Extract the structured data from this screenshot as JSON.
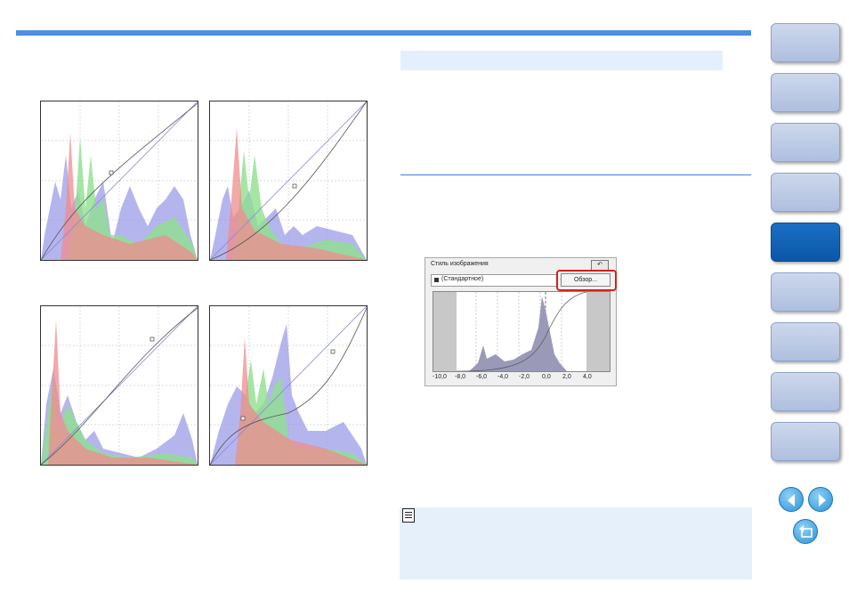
{
  "colors": {
    "accent": "#4f8ee0",
    "section_bg": "#e3effc",
    "note_bg": "#e5f0fb",
    "nav_active": "#0b57a8",
    "nav_inactive": "#b8c8e4",
    "highlight": "#d81e1e"
  },
  "panel": {
    "title": "Стиль изображения",
    "style_value": "(Стандартное)",
    "browse_label": "Обзор...",
    "axis_ticks": [
      "-10,0",
      "-8,0",
      "-6,0",
      "-4,0",
      "-2,0",
      "0,0",
      "2,0",
      "4,0"
    ]
  },
  "nav": {
    "buttons": [
      "",
      "",
      "",
      "",
      "",
      "",
      "",
      "",
      ""
    ],
    "active_index": 4
  },
  "icons": [
    "note-icon",
    "prev-page-icon",
    "next-page-icon",
    "return-icon",
    "reset-icon",
    "lock-icon",
    "dropdown-arrow-icon"
  ]
}
